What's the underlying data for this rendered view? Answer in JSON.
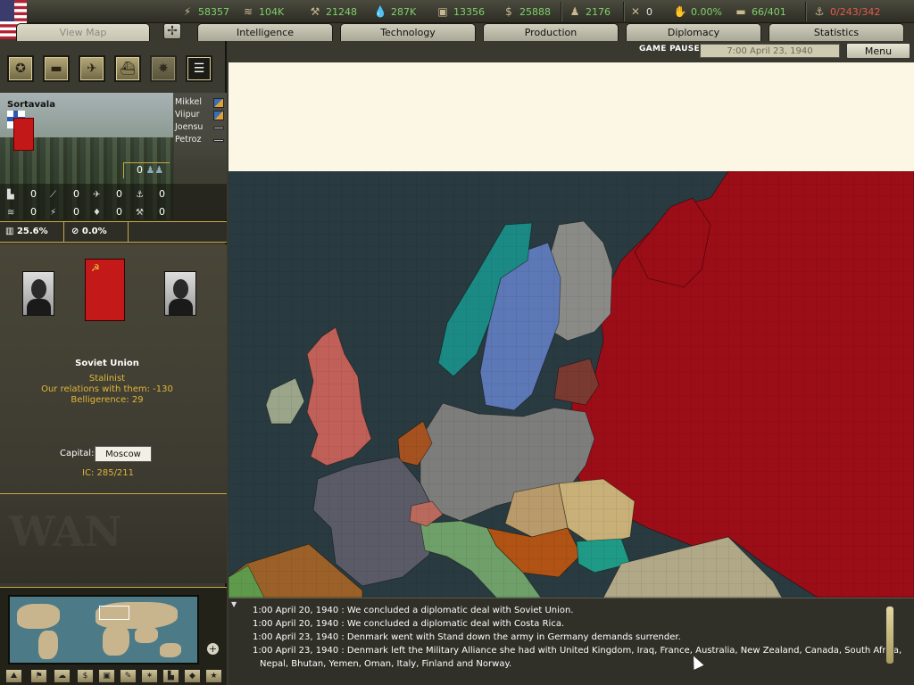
{
  "resources": [
    {
      "icon": "energy-icon",
      "glyph": "⚡",
      "value": "58357",
      "color": "green"
    },
    {
      "icon": "metal-icon",
      "glyph": "≋",
      "value": "104K",
      "color": "green"
    },
    {
      "icon": "rare-materials-icon",
      "glyph": "⚒",
      "value": "21248",
      "color": "green"
    },
    {
      "icon": "oil-icon",
      "glyph": "💧",
      "value": "287K",
      "color": "green"
    },
    {
      "icon": "supplies-icon",
      "glyph": "▣",
      "value": "13356",
      "color": "green"
    },
    {
      "icon": "money-icon",
      "glyph": "$",
      "value": "25888",
      "color": "green"
    },
    {
      "icon": "manpower-icon",
      "glyph": "♟",
      "value": "2176",
      "color": "green"
    },
    {
      "icon": "transports-icon",
      "glyph": "✕",
      "value": "0",
      "color": "white"
    },
    {
      "icon": "dissent-icon",
      "glyph": "✋",
      "value": "0.00%",
      "color": "green"
    },
    {
      "icon": "convoys-icon",
      "glyph": "▬",
      "value": "66/401",
      "color": "green"
    },
    {
      "icon": "escorts-icon",
      "glyph": "⚓",
      "value": "0/243/342",
      "color": "red"
    }
  ],
  "tabs": [
    "View Map",
    "Intelligence",
    "Technology",
    "Production",
    "Diplomacy",
    "Statistics"
  ],
  "status": {
    "paused": "GAME PAUSED",
    "date": "7:00 April 23, 1940",
    "menu": "Menu"
  },
  "province": {
    "name": "Sortavala",
    "neighbors": [
      "Mikkel",
      "Viipur",
      "Joensu",
      "Petroz"
    ],
    "units": "0",
    "stats_row1": [
      "0",
      "0",
      "0",
      "0"
    ],
    "stats_row2": [
      "0",
      "0",
      "0",
      "0"
    ],
    "pct1": "25.6%",
    "pct2": "0.0%"
  },
  "country": {
    "name": "Soviet Union",
    "ideology": "Stalinist",
    "relations": "Our relations with them: -130",
    "belligerence": "Belligerence: 29",
    "capital_label": "Capital:",
    "capital": "Moscow",
    "ic": "IC: 285/211",
    "flag_symbol": "☭"
  },
  "log": [
    "1:00 April 20, 1940 : We concluded a diplomatic deal with Soviet Union.",
    "1:00 April 20, 1940 : We concluded a diplomatic deal with Costa Rica.",
    "1:00 April 23, 1940 : Denmark went with Stand down the army in Germany demands surrender.",
    "1:00 April 23, 1940 : Denmark left the Military Alliance she had with United Kingdom, Iraq, France, Australia, New Zealand, Canada, South Africa,",
    "Nepal, Bhutan, Yemen, Oman, Italy, Finland and Norway."
  ],
  "colors": {
    "soviet": "#9b0d17",
    "sea": "#293b40",
    "germany": "#7d7d7b",
    "uk": "#c06058",
    "france": "#5a5b66",
    "sweden": "#5d78b6",
    "norway": "#1c8a84",
    "finland": "#8a8a86",
    "italy": "#6fa06a",
    "spain": "#9c6128",
    "romania": "#c8b078",
    "yugoslavia": "#b05314",
    "bulgaria": "#1f9a86"
  },
  "map_labels": {
    "minimap": "World",
    "zoom_in": "+",
    "zoom_out": "−"
  }
}
